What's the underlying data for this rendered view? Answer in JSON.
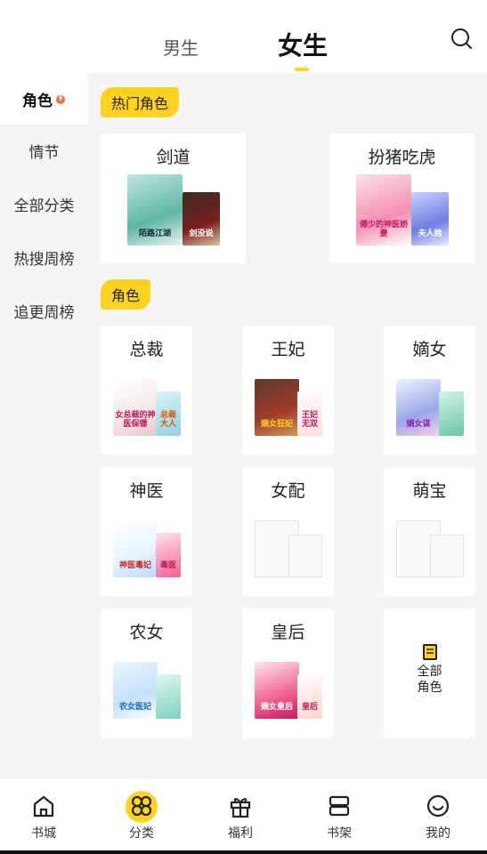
{
  "header": {
    "tab_male": "男生",
    "tab_female": "女生",
    "search_icon": "search-icon",
    "accent_color": "#ffd21f"
  },
  "sidebar": {
    "items": [
      {
        "label": "角色",
        "active": true,
        "icon": "fire-icon"
      },
      {
        "label": "情节"
      },
      {
        "label": "全部分类"
      },
      {
        "label": "热搜周榜"
      },
      {
        "label": "追更周榜"
      }
    ]
  },
  "hot_section": {
    "tag": "热门角色",
    "cards": [
      {
        "title": "剑道",
        "covers": [
          "陌路江湖",
          "剑没说"
        ]
      },
      {
        "title": "扮猪吃虎",
        "covers": [
          "傅少的神医娇妻",
          "夫人她"
        ]
      }
    ]
  },
  "role_section": {
    "tag": "角色",
    "cards": [
      {
        "title": "总裁",
        "covers": [
          "女总裁的神医保镖",
          "总裁大人"
        ]
      },
      {
        "title": "王妃",
        "covers": [
          "嫡女狂妃",
          "王妃无双"
        ]
      },
      {
        "title": "嫡女",
        "covers": [
          "嫡女谋",
          ""
        ]
      },
      {
        "title": "神医",
        "covers": [
          "神医毒妃",
          "毒医"
        ]
      },
      {
        "title": "女配",
        "covers": []
      },
      {
        "title": "萌宝",
        "covers": []
      },
      {
        "title": "农女",
        "covers": [
          "农女医妃",
          ""
        ]
      },
      {
        "title": "皇后",
        "covers": [
          "嫡女皇后",
          "皇后"
        ]
      }
    ],
    "all_card": {
      "line1": "全部",
      "line2": "角色",
      "icon": "document-icon"
    }
  },
  "bottom_nav": {
    "items": [
      {
        "label": "书城",
        "icon": "home-icon"
      },
      {
        "label": "分类",
        "icon": "category-icon",
        "active": true
      },
      {
        "label": "福利",
        "icon": "gift-icon"
      },
      {
        "label": "书架",
        "icon": "bookshelf-icon"
      },
      {
        "label": "我的",
        "icon": "profile-icon"
      }
    ]
  }
}
